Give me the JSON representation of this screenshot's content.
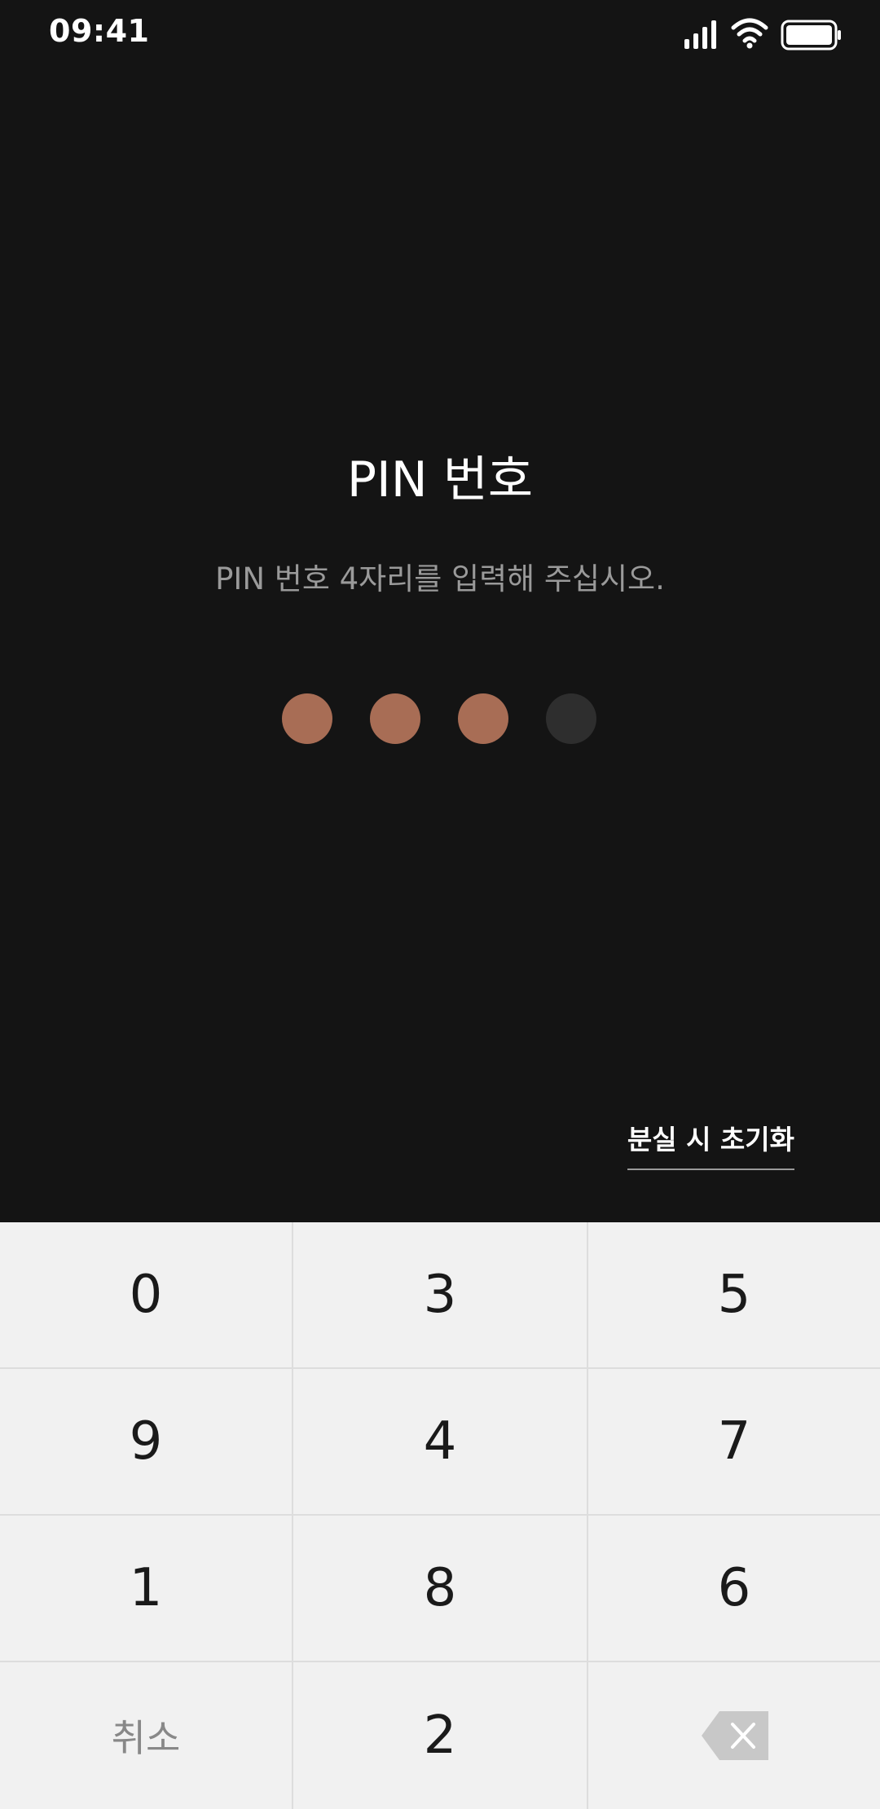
{
  "status_bar": {
    "time": "09:41",
    "icons": [
      "signal-icon",
      "wifi-icon",
      "battery-icon"
    ]
  },
  "pin": {
    "title": "PIN 번호",
    "subtitle": "PIN 번호 4자리를 입력해 주십시오.",
    "total_digits": 4,
    "entered_digits": 3,
    "filled_color": "#a86d55",
    "empty_color": "#2e2e2e"
  },
  "reset_link": "분실 시 초기화",
  "keypad": {
    "rows": [
      [
        "0",
        "3",
        "5"
      ],
      [
        "9",
        "4",
        "7"
      ],
      [
        "1",
        "8",
        "6"
      ]
    ],
    "bottom": {
      "cancel": "취소",
      "digit": "2",
      "backspace_icon": "backspace-icon"
    }
  },
  "colors": {
    "background": "#141414",
    "keypad_background": "#f1f1f1",
    "accent": "#a86d55"
  }
}
